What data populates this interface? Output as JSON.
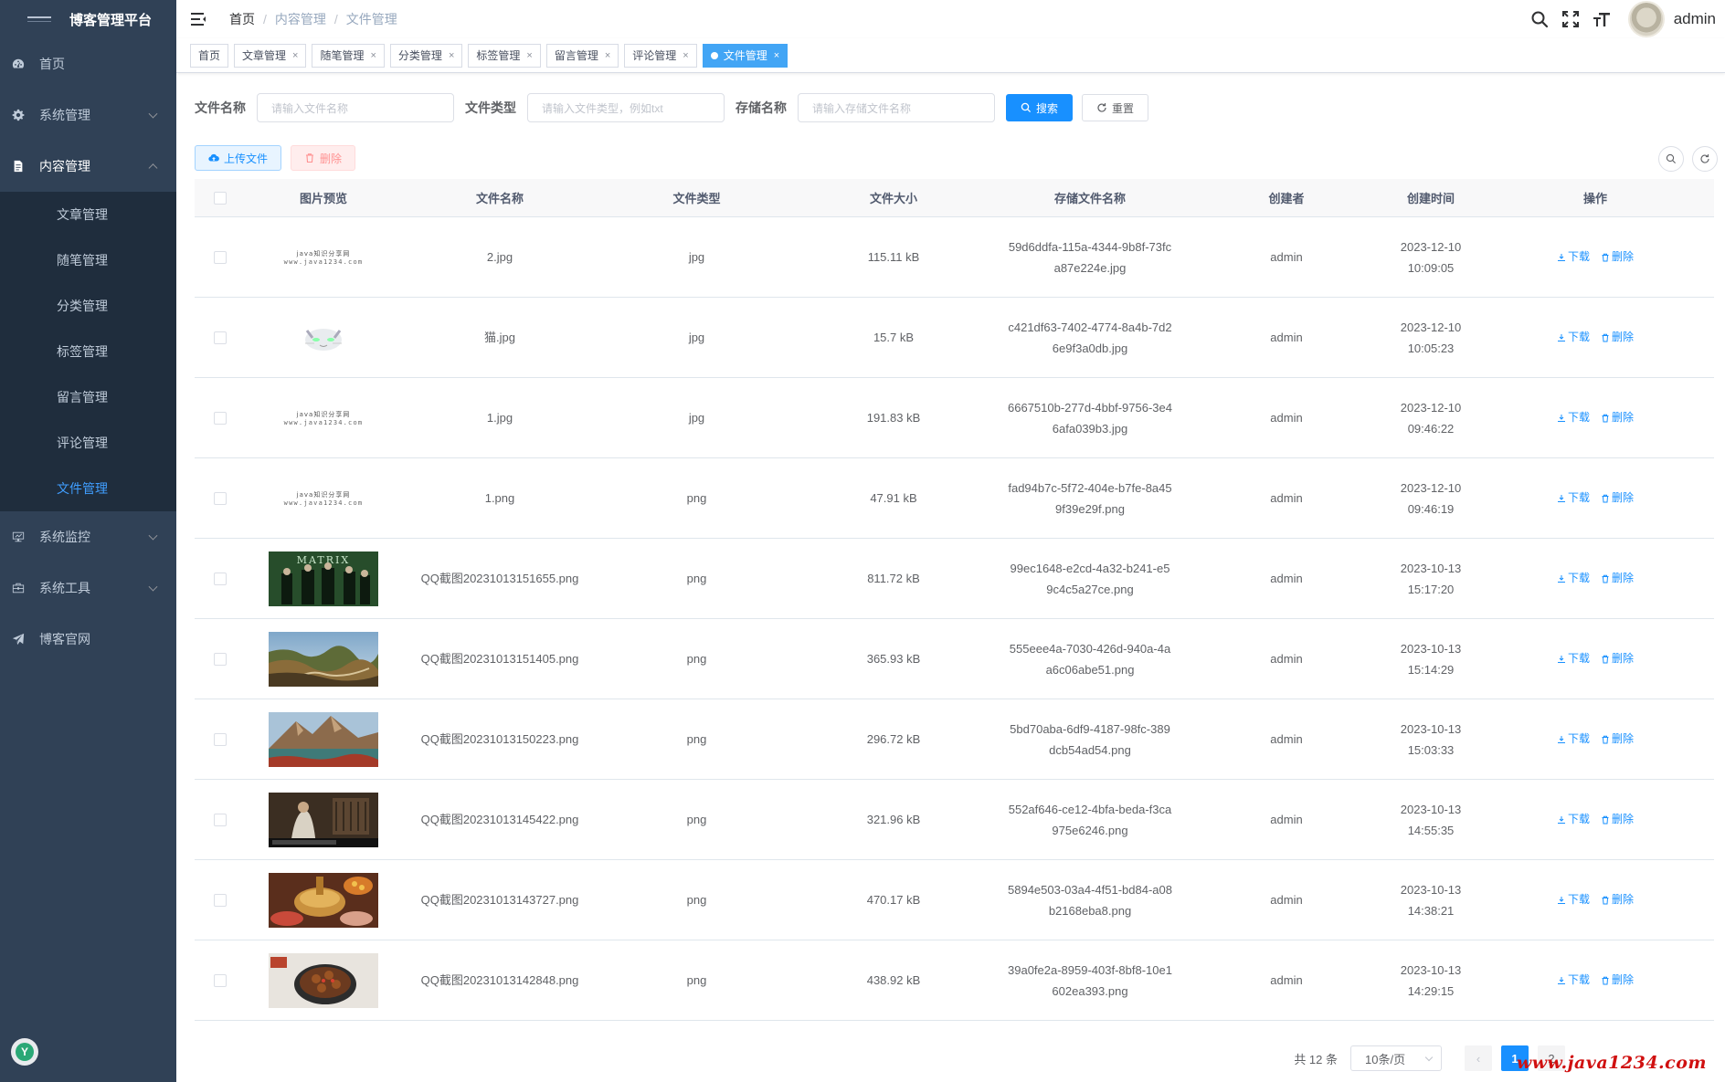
{
  "app": {
    "title": "博客管理平台"
  },
  "sidebar": {
    "menu": [
      {
        "label": "首页",
        "icon": "dashboard-icon"
      },
      {
        "label": "系统管理",
        "icon": "gear-icon"
      },
      {
        "label": "内容管理",
        "icon": "document-icon"
      }
    ],
    "sub_items": [
      {
        "label": "文章管理"
      },
      {
        "label": "随笔管理"
      },
      {
        "label": "分类管理"
      },
      {
        "label": "标签管理"
      },
      {
        "label": "留言管理"
      },
      {
        "label": "评论管理"
      },
      {
        "label": "文件管理"
      }
    ],
    "bottom_menu": [
      {
        "label": "系统监控",
        "icon": "monitor-icon"
      },
      {
        "label": "系统工具",
        "icon": "toolbox-icon"
      },
      {
        "label": "博客官网",
        "icon": "send-icon"
      }
    ]
  },
  "header": {
    "breadcrumb": [
      "首页",
      "内容管理",
      "文件管理"
    ],
    "separator": "/",
    "user": "admin"
  },
  "tags": [
    {
      "label": "首页",
      "closable": false
    },
    {
      "label": "文章管理",
      "closable": true
    },
    {
      "label": "随笔管理",
      "closable": true
    },
    {
      "label": "分类管理",
      "closable": true
    },
    {
      "label": "标签管理",
      "closable": true
    },
    {
      "label": "留言管理",
      "closable": true
    },
    {
      "label": "评论管理",
      "closable": true
    },
    {
      "label": "文件管理",
      "closable": true,
      "active": true
    }
  ],
  "tag_close": "×",
  "search": {
    "name_label": "文件名称",
    "name_placeholder": "请输入文件名称",
    "type_label": "文件类型",
    "type_placeholder": "请输入文件类型，例如txt",
    "store_label": "存储名称",
    "store_placeholder": "请输入存储文件名称",
    "search_btn": "搜索",
    "reset_btn": "重置"
  },
  "toolbar": {
    "upload": "上传文件",
    "delete": "删除"
  },
  "table": {
    "headers": [
      "图片预览",
      "文件名称",
      "文件类型",
      "文件大小",
      "存储文件名称",
      "创建者",
      "创建时间",
      "操作"
    ],
    "ops": {
      "download": "下载",
      "delete": "删除"
    },
    "rows": [
      {
        "thumb": "logo",
        "name": "2.jpg",
        "type": "jpg",
        "size": "115.11 kB",
        "store1": "59d6ddfa-115a-4344-9b8f-73fc",
        "store2": "a87e224e.jpg",
        "creator": "admin",
        "date": "2023-12-10",
        "time": "10:09:05"
      },
      {
        "thumb": "cat",
        "name": "猫.jpg",
        "type": "jpg",
        "size": "15.7 kB",
        "store1": "c421df63-7402-4774-8a4b-7d2",
        "store2": "6e9f3a0db.jpg",
        "creator": "admin",
        "date": "2023-12-10",
        "time": "10:05:23"
      },
      {
        "thumb": "logo",
        "name": "1.jpg",
        "type": "jpg",
        "size": "191.83 kB",
        "store1": "6667510b-277d-4bbf-9756-3e4",
        "store2": "6afa039b3.jpg",
        "creator": "admin",
        "date": "2023-12-10",
        "time": "09:46:22"
      },
      {
        "thumb": "logo",
        "name": "1.png",
        "type": "png",
        "size": "47.91 kB",
        "store1": "fad94b7c-5f72-404e-b7fe-8a45",
        "store2": "9f39e29f.png",
        "creator": "admin",
        "date": "2023-12-10",
        "time": "09:46:19"
      },
      {
        "thumb": "matrix",
        "name": "QQ截图20231013151655.png",
        "type": "png",
        "size": "811.72 kB",
        "store1": "99ec1648-e2cd-4a32-b241-e5",
        "store2": "9c4c5a27ce.png",
        "creator": "admin",
        "date": "2023-10-13",
        "time": "15:17:20"
      },
      {
        "thumb": "canyon",
        "name": "QQ截图20231013151405.png",
        "type": "png",
        "size": "365.93 kB",
        "store1": "555eee4a-7030-426d-940a-4a",
        "store2": "a6c06abe51.png",
        "creator": "admin",
        "date": "2023-10-13",
        "time": "15:14:29"
      },
      {
        "thumb": "lake",
        "name": "QQ截图20231013150223.png",
        "type": "png",
        "size": "296.72 kB",
        "store1": "5bd70aba-6df9-4187-98fc-389",
        "store2": "dcb54ad54.png",
        "creator": "admin",
        "date": "2023-10-13",
        "time": "15:03:33"
      },
      {
        "thumb": "room",
        "name": "QQ截图20231013145422.png",
        "type": "png",
        "size": "321.96 kB",
        "store1": "552af646-ce12-4bfa-beda-f3ca",
        "store2": "975e6246.png",
        "creator": "admin",
        "date": "2023-10-13",
        "time": "14:55:35"
      },
      {
        "thumb": "hotpot",
        "name": "QQ截图20231013143727.png",
        "type": "png",
        "size": "470.17 kB",
        "store1": "5894e503-03a4-4f51-bd84-a08",
        "store2": "b2168eba8.png",
        "creator": "admin",
        "date": "2023-10-13",
        "time": "14:38:21"
      },
      {
        "thumb": "dish",
        "name": "QQ截图20231013142848.png",
        "type": "png",
        "size": "438.92 kB",
        "store1": "39a0fe2a-8959-403f-8bf8-10e1",
        "store2": "602ea393.png",
        "creator": "admin",
        "date": "2023-10-13",
        "time": "14:29:15"
      }
    ]
  },
  "pagination": {
    "total": "共 12 条",
    "page_size": "10条/页",
    "prev": "‹",
    "current": "1",
    "next_page": "2"
  },
  "watermark": "www.java1234.com",
  "logo_text": {
    "line1": "java知识分享网",
    "line2": "www.java1234.com"
  },
  "matrix_text": "MATRIX",
  "colors": {
    "sidebar_bg": "#304156",
    "submenu_bg": "#1f2d3d",
    "accent": "#1890ff",
    "active_tag": "#42a5f5"
  }
}
